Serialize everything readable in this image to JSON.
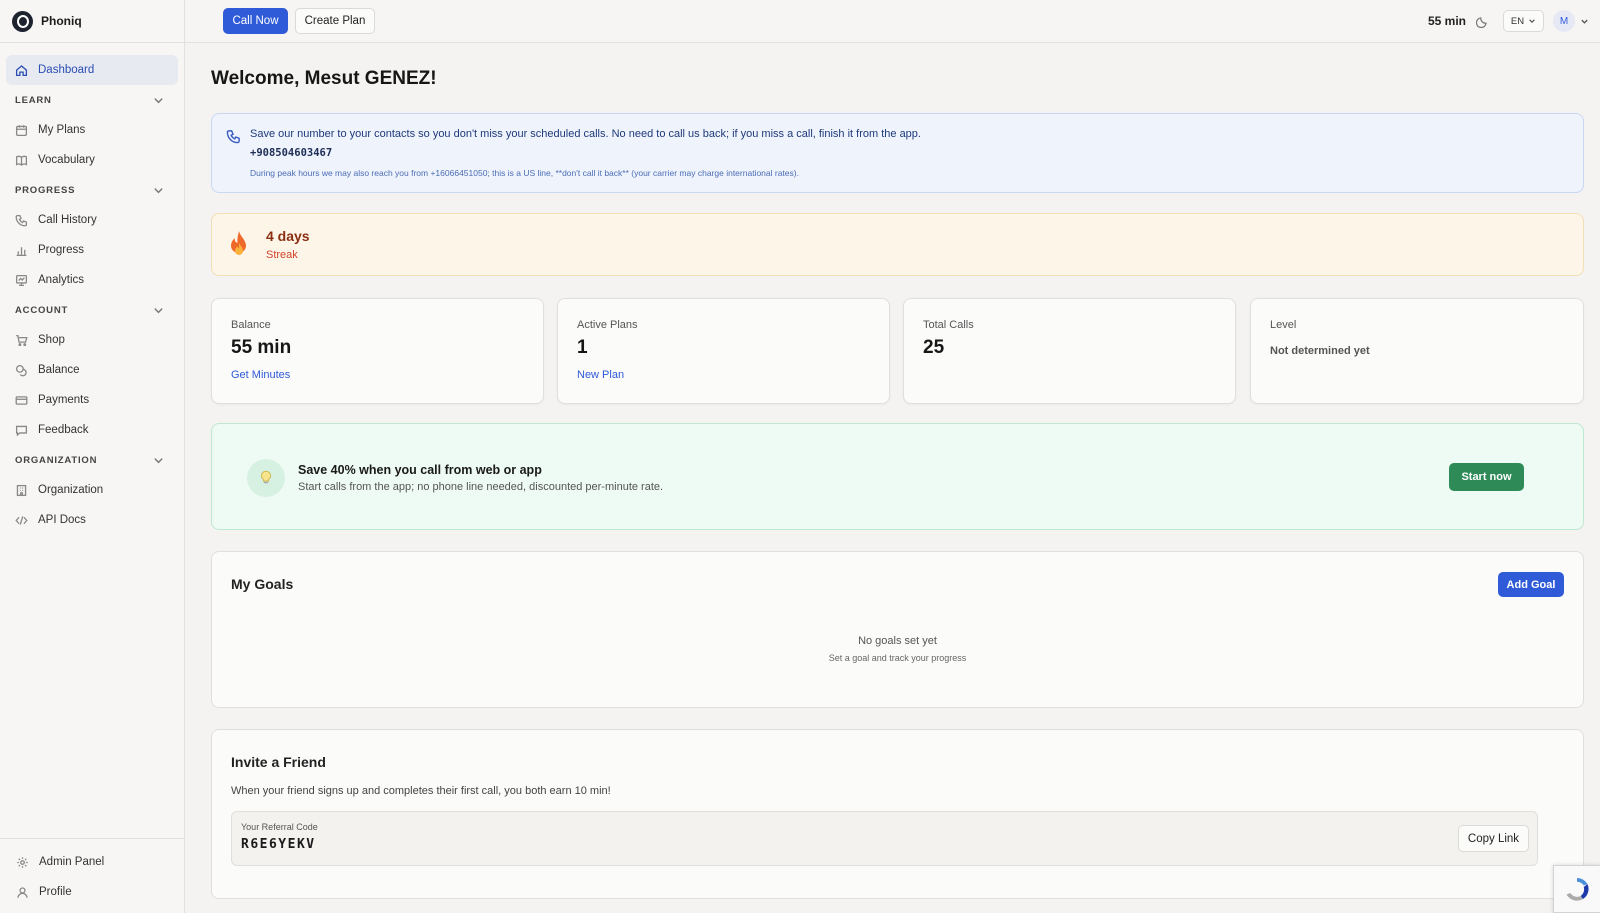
{
  "app": {
    "name": "Phoniq"
  },
  "sidebar": {
    "dashboard": "Dashboard",
    "sections": {
      "learn": "LEARN",
      "progress": "PROGRESS",
      "account": "ACCOUNT",
      "organization": "ORGANIZATION"
    },
    "items": {
      "my_plans": "My Plans",
      "vocabulary": "Vocabulary",
      "call_history": "Call History",
      "progress": "Progress",
      "analytics": "Analytics",
      "shop": "Shop",
      "balance": "Balance",
      "payments": "Payments",
      "feedback": "Feedback",
      "organization": "Organization",
      "api_docs": "API Docs",
      "admin_panel": "Admin Panel",
      "profile": "Profile"
    }
  },
  "topbar": {
    "call_now": "Call Now",
    "create_plan": "Create Plan",
    "minutes": "55 min",
    "language": "EN",
    "avatar_initial": "M"
  },
  "welcome": "Welcome, Mesut GENEZ!",
  "info_banner": {
    "text": "Save our number to your contacts so you don't miss your scheduled calls. No need to call us back; if you miss a call, finish it from the app.",
    "number": "+908504603467",
    "note": "During peak hours we may also reach you from +16066451050; this is a US line, **don't call it back** (your carrier may charge international rates)."
  },
  "streak": {
    "days": "4 days",
    "label": "Streak"
  },
  "stats": {
    "balance": {
      "label": "Balance",
      "value": "55 min",
      "link": "Get Minutes"
    },
    "active_plans": {
      "label": "Active Plans",
      "value": "1",
      "link": "New Plan"
    },
    "total_calls": {
      "label": "Total Calls",
      "value": "25"
    },
    "level": {
      "label": "Level",
      "value": "Not determined yet"
    }
  },
  "promo": {
    "title": "Save 40% when you call from web or app",
    "subtitle": "Start calls from the app; no phone line needed, discounted per-minute rate.",
    "button": "Start now"
  },
  "goals": {
    "title": "My Goals",
    "add_button": "Add Goal",
    "empty": "No goals set yet",
    "empty_sub": "Set a goal and track your progress"
  },
  "invite": {
    "title": "Invite a Friend",
    "description": "When your friend signs up and completes their first call, you both earn 10 min!",
    "code_label": "Your Referral Code",
    "code": "R6E6YEKV",
    "copy_button": "Copy Link"
  },
  "colors": {
    "primary": "#2f5ad8",
    "success": "#2e8b57",
    "streak_text": "#8a2e12"
  }
}
